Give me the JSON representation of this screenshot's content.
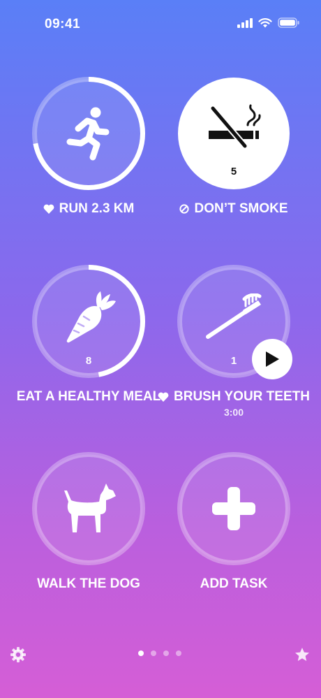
{
  "status_bar": {
    "time": "09:41"
  },
  "tasks": [
    {
      "label": "RUN 2.3 KM",
      "prefix_icon": "heart-icon",
      "icon": "runner-icon",
      "progress": 0.72,
      "count": ""
    },
    {
      "label": "DON’T SMOKE",
      "prefix_icon": "prohibited-icon",
      "icon": "no-smoking-icon",
      "progress": 1.0,
      "count": "5"
    },
    {
      "label": "EAT A HEALTHY MEAL",
      "prefix_icon": "",
      "icon": "carrot-icon",
      "progress": 0.47,
      "count": "8"
    },
    {
      "label": "BRUSH YOUR TEETH",
      "prefix_icon": "heart-icon",
      "icon": "toothbrush-icon",
      "progress": 0.0,
      "count": "1",
      "timer": "3:00",
      "action_icon": "play-icon"
    },
    {
      "label": "WALK THE DOG",
      "prefix_icon": "",
      "icon": "dog-icon",
      "progress": 0.0,
      "count": ""
    },
    {
      "label": "ADD TASK",
      "prefix_icon": "",
      "icon": "plus-icon",
      "progress": 0.0,
      "count": ""
    }
  ],
  "footer": {
    "left_icon": "gear-icon",
    "right_icon": "star-icon",
    "page_count": 4,
    "active_page": 1
  },
  "colors": {
    "gradient_top": "#5a7ff7",
    "gradient_bottom": "#d55ed6",
    "ring_track": "rgba(255,255,255,0.3)",
    "ring_fill": "#ffffff",
    "dark_icon": "#111111"
  }
}
